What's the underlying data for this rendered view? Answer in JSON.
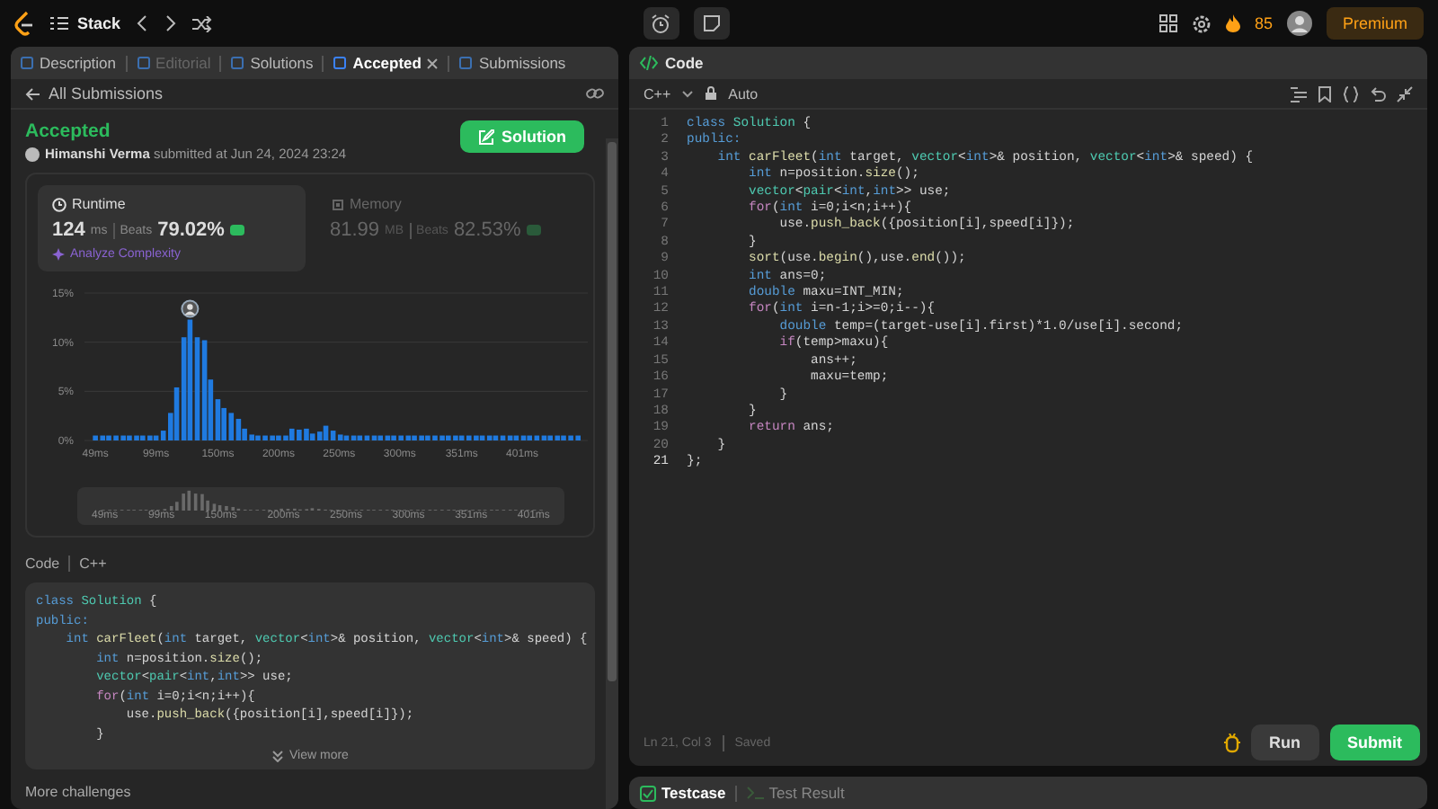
{
  "top_bar": {
    "list_title": "Stack",
    "streak": "85",
    "premium": "Premium"
  },
  "tabs": [
    {
      "label": "Description",
      "selected": false,
      "disabled": false
    },
    {
      "label": "Editorial",
      "selected": false,
      "disabled": true
    },
    {
      "label": "Solutions",
      "selected": false,
      "disabled": false
    },
    {
      "label": "Accepted",
      "selected": true,
      "disabled": false
    },
    {
      "label": "Submissions",
      "selected": false,
      "disabled": false
    }
  ],
  "submission": {
    "back": "All Submissions",
    "status": "Accepted",
    "byline": "**Himanshi Verma** submitted at Jun 24, 2024 23:24",
    "solution_button": "Solution"
  },
  "stats": [
    {
      "kind": "runtime",
      "title": "Runtime",
      "value": "124",
      "unit": "ms",
      "beats_label": "Beats",
      "beats": "79.02%",
      "selected": true,
      "link": "Analyze Complexity"
    },
    {
      "kind": "memory",
      "title": "Memory",
      "value": "81.99",
      "unit": "MB",
      "beats_label": "Beats",
      "beats": "82.53%",
      "selected": false
    }
  ],
  "chart_data": {
    "type": "bar",
    "xlim": [
      40,
      455
    ],
    "ylim": [
      0,
      15
    ],
    "x": [
      49,
      55,
      60,
      66,
      72,
      77,
      83,
      88,
      94,
      99,
      105,
      111,
      116,
      122,
      127,
      133,
      139,
      144,
      150,
      155,
      161,
      167,
      172,
      178,
      183,
      189,
      195,
      200,
      206,
      211,
      217,
      223,
      228,
      234,
      239,
      245,
      251,
      256,
      262,
      267,
      273,
      279,
      284,
      290,
      295,
      301,
      307,
      312,
      318,
      323,
      329,
      335,
      340,
      346,
      351,
      357,
      363,
      368,
      374,
      379,
      385,
      391,
      396,
      402,
      407,
      413,
      419,
      424,
      430,
      435,
      441,
      447
    ],
    "values": [
      0.5,
      0.5,
      0.5,
      0.5,
      0.5,
      0.5,
      0.5,
      0.5,
      0.5,
      0.5,
      1.0,
      2.8,
      5.4,
      10.5,
      12.3,
      10.5,
      10.2,
      6.2,
      4.2,
      3.3,
      2.8,
      2.2,
      1.2,
      0.6,
      0.5,
      0.5,
      0.5,
      0.5,
      0.5,
      1.2,
      1.1,
      1.2,
      0.7,
      0.9,
      1.5,
      1.0,
      0.6,
      0.5,
      0.5,
      0.5,
      0.5,
      0.5,
      0.5,
      0.5,
      0.5,
      0.5,
      0.5,
      0.5,
      0.5,
      0.5,
      0.5,
      0.5,
      0.5,
      0.5,
      0.5,
      0.5,
      0.5,
      0.5,
      0.5,
      0.5,
      0.5,
      0.5,
      0.5,
      0.5,
      0.5,
      0.5,
      0.5,
      0.5,
      0.5,
      0.5,
      0.5,
      0.5
    ],
    "yticks": [
      {
        "value": 0,
        "label": "0%"
      },
      {
        "value": 5,
        "label": "5%"
      },
      {
        "value": 10,
        "label": "10%"
      },
      {
        "value": 15,
        "label": "15%"
      }
    ],
    "xticks": [
      {
        "value": 49,
        "label": "49ms"
      },
      {
        "value": 99,
        "label": "99ms"
      },
      {
        "value": 150,
        "label": "150ms"
      },
      {
        "value": 200,
        "label": "200ms"
      },
      {
        "value": 250,
        "label": "250ms"
      },
      {
        "value": 300,
        "label": "300ms"
      },
      {
        "value": 351,
        "label": "351ms"
      },
      {
        "value": 401,
        "label": "401ms"
      }
    ]
  },
  "overview_labels": [
    "49ms",
    "99ms",
    "150ms",
    "200ms",
    "250ms",
    "300ms",
    "351ms",
    "401ms"
  ],
  "code_preview": {
    "label": "Code",
    "language": "C++",
    "more": "View more",
    "lines": [
      [
        {
          "text": "class ",
          "kind": "keyword"
        },
        {
          "text": "Solution",
          "kind": "type"
        },
        {
          "text": " {",
          "kind": "plain"
        }
      ],
      [
        {
          "text": "public:",
          "kind": "keyword"
        }
      ],
      [
        {
          "text": "    int ",
          "kind": "keyword"
        },
        {
          "text": "carFleet",
          "kind": "function"
        },
        {
          "text": "(",
          "kind": "plain"
        },
        {
          "text": "int",
          "kind": "keyword"
        },
        {
          "text": " target, ",
          "kind": "plain"
        },
        {
          "text": "vector",
          "kind": "type"
        },
        {
          "text": "<",
          "kind": "plain"
        },
        {
          "text": "int",
          "kind": "keyword"
        },
        {
          "text": ">& position, ",
          "kind": "plain"
        },
        {
          "text": "vector",
          "kind": "type"
        },
        {
          "text": "<",
          "kind": "plain"
        },
        {
          "text": "int",
          "kind": "keyword"
        },
        {
          "text": ">& speed) {",
          "kind": "plain"
        }
      ],
      [
        {
          "text": "        int",
          "kind": "keyword"
        },
        {
          "text": " n=position.",
          "kind": "plain"
        },
        {
          "text": "size",
          "kind": "function"
        },
        {
          "text": "();",
          "kind": "plain"
        }
      ],
      [
        {
          "text": "        vector",
          "kind": "type"
        },
        {
          "text": "<",
          "kind": "plain"
        },
        {
          "text": "pair",
          "kind": "type"
        },
        {
          "text": "<",
          "kind": "plain"
        },
        {
          "text": "int",
          "kind": "keyword"
        },
        {
          "text": ",",
          "kind": "plain"
        },
        {
          "text": "int",
          "kind": "keyword"
        },
        {
          "text": ">> use;",
          "kind": "plain"
        }
      ],
      [
        {
          "text": "        for",
          "kind": "control"
        },
        {
          "text": "(",
          "kind": "plain"
        },
        {
          "text": "int",
          "kind": "keyword"
        },
        {
          "text": " i=0;i<n;i++){",
          "kind": "plain"
        }
      ],
      [
        {
          "text": "            use.",
          "kind": "plain"
        },
        {
          "text": "push_back",
          "kind": "function"
        },
        {
          "text": "({position[i],speed[i]});",
          "kind": "plain"
        }
      ],
      [
        {
          "text": "        }",
          "kind": "plain"
        }
      ]
    ]
  },
  "more_challenges": "More challenges",
  "editor": {
    "title": "Code",
    "language": "C++",
    "mode": "Auto",
    "cursor": "Ln 21, Col 3",
    "save_state": "Saved",
    "run": "Run",
    "submit": "Submit",
    "lines": [
      {
        "number": "1",
        "current": false,
        "tokens": [
          {
            "text": "class ",
            "kind": "keyword"
          },
          {
            "text": "Solution",
            "kind": "type"
          },
          {
            "text": " {",
            "kind": "plain"
          }
        ]
      },
      {
        "number": "2",
        "current": false,
        "tokens": [
          {
            "text": "public:",
            "kind": "keyword"
          }
        ]
      },
      {
        "number": "3",
        "current": false,
        "tokens": [
          {
            "text": "    int ",
            "kind": "keyword"
          },
          {
            "text": "carFleet",
            "kind": "function"
          },
          {
            "text": "(",
            "kind": "plain"
          },
          {
            "text": "int",
            "kind": "keyword"
          },
          {
            "text": " target, ",
            "kind": "plain"
          },
          {
            "text": "vector",
            "kind": "type"
          },
          {
            "text": "<",
            "kind": "plain"
          },
          {
            "text": "int",
            "kind": "keyword"
          },
          {
            "text": ">& position, ",
            "kind": "plain"
          },
          {
            "text": "vector",
            "kind": "type"
          },
          {
            "text": "<",
            "kind": "plain"
          },
          {
            "text": "int",
            "kind": "keyword"
          },
          {
            "text": ">& speed) {",
            "kind": "plain"
          }
        ]
      },
      {
        "number": "4",
        "current": false,
        "tokens": [
          {
            "text": "        int",
            "kind": "keyword"
          },
          {
            "text": " n=position.",
            "kind": "plain"
          },
          {
            "text": "size",
            "kind": "function"
          },
          {
            "text": "();",
            "kind": "plain"
          }
        ]
      },
      {
        "number": "5",
        "current": false,
        "tokens": [
          {
            "text": "        vector",
            "kind": "type"
          },
          {
            "text": "<",
            "kind": "plain"
          },
          {
            "text": "pair",
            "kind": "type"
          },
          {
            "text": "<",
            "kind": "plain"
          },
          {
            "text": "int",
            "kind": "keyword"
          },
          {
            "text": ",",
            "kind": "plain"
          },
          {
            "text": "int",
            "kind": "keyword"
          },
          {
            "text": ">> use;",
            "kind": "plain"
          }
        ]
      },
      {
        "number": "6",
        "current": false,
        "tokens": [
          {
            "text": "        for",
            "kind": "control"
          },
          {
            "text": "(",
            "kind": "plain"
          },
          {
            "text": "int",
            "kind": "keyword"
          },
          {
            "text": " i=0;i<n;i++){",
            "kind": "plain"
          }
        ]
      },
      {
        "number": "7",
        "current": false,
        "tokens": [
          {
            "text": "            use.",
            "kind": "plain"
          },
          {
            "text": "push_back",
            "kind": "function"
          },
          {
            "text": "({position[i],speed[i]});",
            "kind": "plain"
          }
        ]
      },
      {
        "number": "8",
        "current": false,
        "tokens": [
          {
            "text": "        }",
            "kind": "plain"
          }
        ]
      },
      {
        "number": "9",
        "current": false,
        "tokens": [
          {
            "text": "        sort",
            "kind": "function"
          },
          {
            "text": "(use.",
            "kind": "plain"
          },
          {
            "text": "begin",
            "kind": "function"
          },
          {
            "text": "(),use.",
            "kind": "plain"
          },
          {
            "text": "end",
            "kind": "function"
          },
          {
            "text": "());",
            "kind": "plain"
          }
        ]
      },
      {
        "number": "10",
        "current": false,
        "tokens": [
          {
            "text": "        int",
            "kind": "keyword"
          },
          {
            "text": " ans=0;",
            "kind": "plain"
          }
        ]
      },
      {
        "number": "11",
        "current": false,
        "tokens": [
          {
            "text": "        double",
            "kind": "keyword"
          },
          {
            "text": " maxu=INT_MIN;",
            "kind": "plain"
          }
        ]
      },
      {
        "number": "12",
        "current": false,
        "tokens": [
          {
            "text": "        for",
            "kind": "control"
          },
          {
            "text": "(",
            "kind": "plain"
          },
          {
            "text": "int",
            "kind": "keyword"
          },
          {
            "text": " i=n-1;i>=0;i--){",
            "kind": "plain"
          }
        ]
      },
      {
        "number": "13",
        "current": false,
        "tokens": [
          {
            "text": "            double",
            "kind": "keyword"
          },
          {
            "text": " temp=(target-use[i].first)*1.0/use[i].second;",
            "kind": "plain"
          }
        ]
      },
      {
        "number": "14",
        "current": false,
        "tokens": [
          {
            "text": "            if",
            "kind": "control"
          },
          {
            "text": "(temp>maxu){",
            "kind": "plain"
          }
        ]
      },
      {
        "number": "15",
        "current": false,
        "tokens": [
          {
            "text": "                ans++;",
            "kind": "plain"
          }
        ]
      },
      {
        "number": "16",
        "current": false,
        "tokens": [
          {
            "text": "                maxu=temp;",
            "kind": "plain"
          }
        ]
      },
      {
        "number": "17",
        "current": false,
        "tokens": [
          {
            "text": "            }",
            "kind": "plain"
          }
        ]
      },
      {
        "number": "18",
        "current": false,
        "tokens": [
          {
            "text": "        }",
            "kind": "plain"
          }
        ]
      },
      {
        "number": "19",
        "current": false,
        "tokens": [
          {
            "text": "        return",
            "kind": "control"
          },
          {
            "text": " ans;",
            "kind": "plain"
          }
        ]
      },
      {
        "number": "20",
        "current": false,
        "tokens": [
          {
            "text": "    }",
            "kind": "plain"
          }
        ]
      },
      {
        "number": "21",
        "current": true,
        "tokens": [
          {
            "text": "};",
            "kind": "plain"
          }
        ]
      }
    ]
  },
  "bottom_tabs": [
    {
      "label": "Testcase",
      "selected": true
    },
    {
      "label": "Test Result",
      "selected": false
    }
  ]
}
